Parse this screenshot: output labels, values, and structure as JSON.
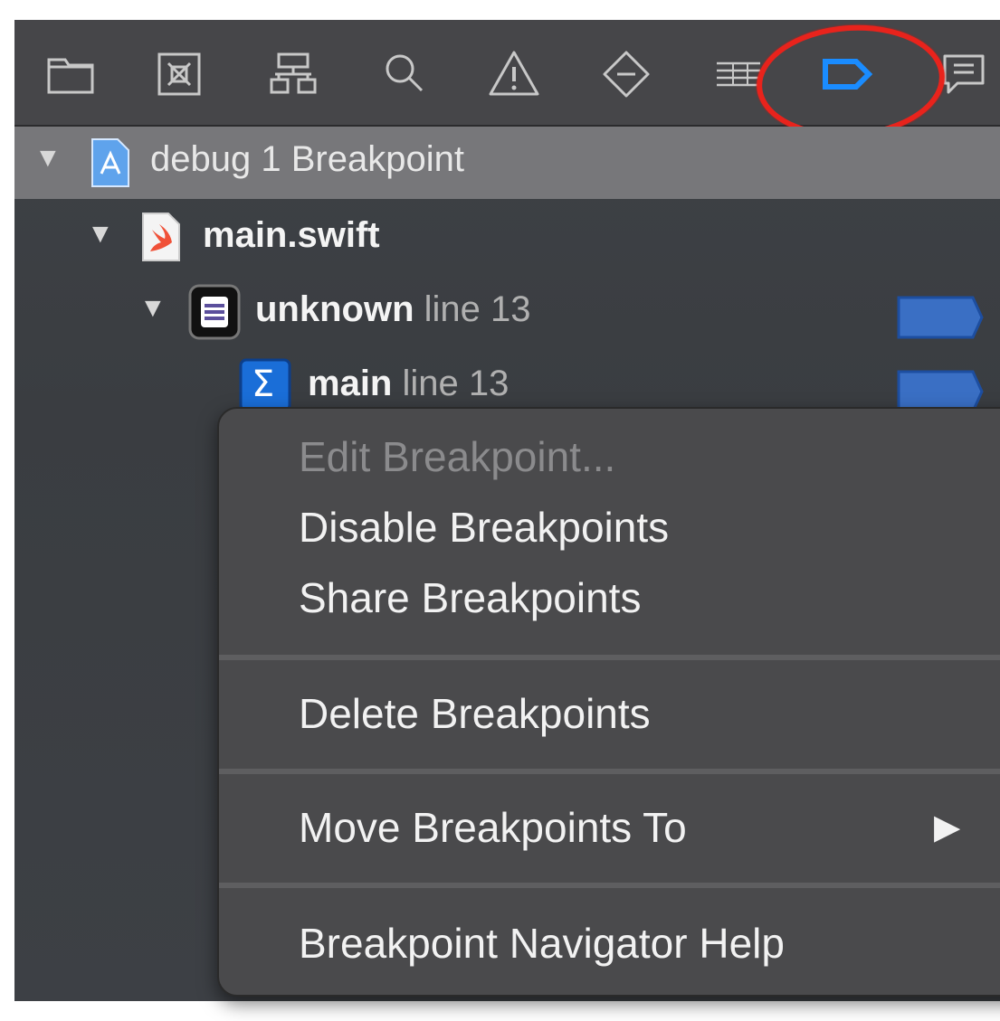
{
  "colors": {
    "accent": "#1a8cff",
    "highlight_circle": "#e8231c",
    "breakpoint_tag": "#3a6fc4"
  },
  "toolbar": {
    "icons": [
      "folder-icon",
      "source-control-icon",
      "hierarchy-icon",
      "search-icon",
      "warning-icon",
      "test-icon",
      "debug-icon",
      "breakpoint-icon",
      "report-icon"
    ],
    "active": "breakpoint-icon"
  },
  "tree": {
    "project": {
      "name": "debug",
      "detail": "1 Breakpoint"
    },
    "file": {
      "name": "main.swift"
    },
    "thread": {
      "name": "unknown",
      "detail": "line 13"
    },
    "frame": {
      "name": "main",
      "detail": "line 13",
      "symbol": "Σ"
    }
  },
  "context_menu": {
    "edit": "Edit Breakpoint...",
    "disable": "Disable Breakpoints",
    "share": "Share Breakpoints",
    "delete": "Delete Breakpoints",
    "move": "Move Breakpoints To",
    "help": "Breakpoint Navigator Help"
  }
}
